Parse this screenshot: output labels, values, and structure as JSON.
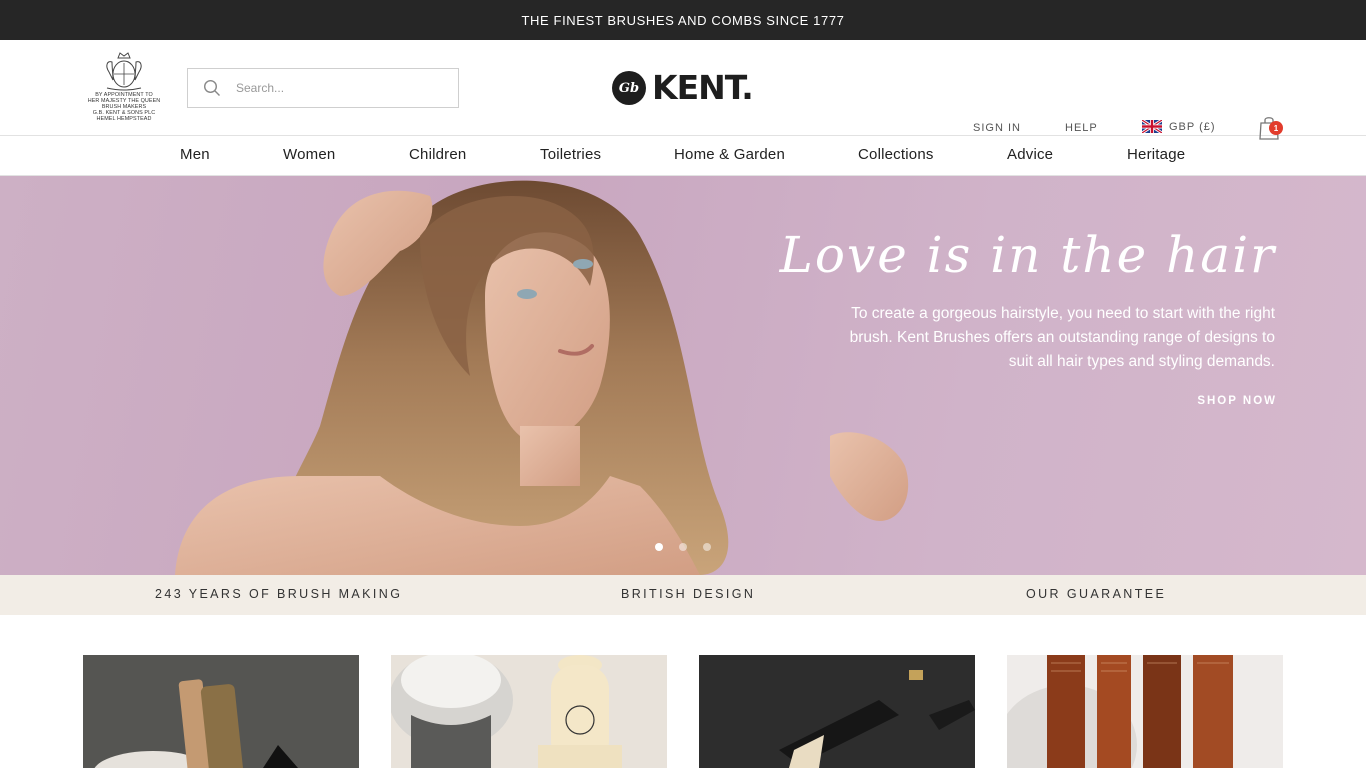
{
  "announcement": "THE FINEST BRUSHES AND COMBS SINCE 1777",
  "warrant": {
    "lines": [
      "BY APPOINTMENT TO",
      "HER MAJESTY THE QUEEN",
      "BRUSH MAKERS",
      "G.B. KENT & SONS PLC",
      "HEMEL HEMPSTEAD"
    ],
    "icon": "royal-crest-icon"
  },
  "search": {
    "placeholder": "Search...",
    "icon": "search-icon"
  },
  "logo": {
    "monogram": "Gb",
    "text": "KENT."
  },
  "header_links": {
    "sign_in": "SIGN IN",
    "help": "HELP",
    "currency": "GBP (£)",
    "currency_flag": "uk-flag-icon",
    "cart_icon": "shopping-bag-icon",
    "cart_count": "1"
  },
  "nav": {
    "items": [
      {
        "label": "Men"
      },
      {
        "label": "Women"
      },
      {
        "label": "Children"
      },
      {
        "label": "Toiletries"
      },
      {
        "label": "Home & Garden"
      },
      {
        "label": "Collections"
      },
      {
        "label": "Advice"
      },
      {
        "label": "Heritage"
      }
    ]
  },
  "hero": {
    "title": "Love is in the hair",
    "description": "To create a gorgeous hairstyle, you need to start with the right brush. Kent Brushes offers an outstanding range of designs to suit all hair types and styling demands.",
    "cta": "SHOP NOW",
    "slide_count": 3,
    "active_slide": 1
  },
  "features": {
    "items": [
      "243 YEARS OF BRUSH MAKING",
      "BRITISH DESIGN",
      "OUR GUARANTEE"
    ]
  },
  "colors": {
    "announcement_bg": "#262626",
    "hero_bg": "#c8a6bf",
    "features_bg": "#f2ede6",
    "cart_badge": "#e23c2c"
  }
}
